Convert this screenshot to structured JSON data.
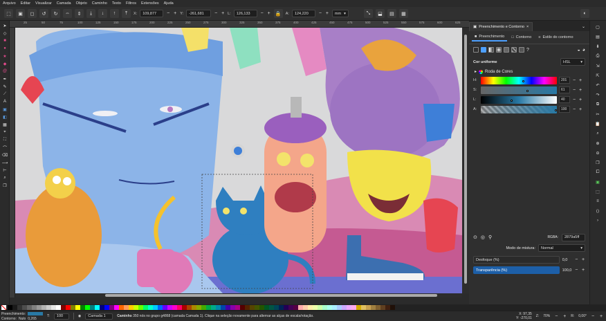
{
  "menu": [
    "Arquivo",
    "Editar",
    "Visualizar",
    "Camada",
    "Objeto",
    "Caminho",
    "Texto",
    "Filtros",
    "Extensões",
    "Ajuda"
  ],
  "toolcontrols": {
    "x_label": "X:",
    "x_value": "109,877",
    "y_label": "Y:",
    "y_value": "-261,681",
    "w_label": "L:",
    "w_value": "126,133",
    "h_label": "A:",
    "h_value": "124,220",
    "unit": "mm"
  },
  "ruler_ticks": [
    "25",
    "50",
    "75",
    "100",
    "125",
    "150",
    "175",
    "200",
    "225",
    "250",
    "275",
    "300",
    "325",
    "350",
    "375",
    "400",
    "425",
    "450",
    "475",
    "500",
    "525",
    "550",
    "575",
    "600",
    "625"
  ],
  "dock": {
    "tab_label": "Preenchimento e Contorno",
    "tabs": [
      "Preenchimento",
      "Contorno",
      "Estilo do contorno"
    ],
    "fill_title": "Cor uniforme",
    "color_mode": "HSL",
    "color_wheel": "Roda de Cores",
    "sliders": [
      {
        "label": "H:",
        "value": "201",
        "knob": 0.56
      },
      {
        "label": "S:",
        "value": "61",
        "knob": 0.61
      },
      {
        "label": "L:",
        "value": "40",
        "knob": 0.4
      },
      {
        "label": "A:",
        "value": "100",
        "knob": 1.0
      }
    ],
    "rgba_label": "RGBA:",
    "rgba_value": "2879a5ff",
    "blend_label": "Modo de mistura:",
    "blend_value": "Normal",
    "blur_label": "Desfoque (%)",
    "blur_value": "0,0",
    "opacity_label": "Transparência (%)",
    "opacity_value": "100,0"
  },
  "status": {
    "fill_label": "Preenchimento:",
    "stroke_label": "Contorno:",
    "stroke_value": "Nulo",
    "stroke_width": "0,265",
    "opacity_label": "T:",
    "opacity_value": "100",
    "layer": "Camada 1",
    "message_bold": "Caminho",
    "message": " 350 nós no grupo g4868 (camada Camada 1). Clique na seleção novamente para alternar as alças de escala/rotação.",
    "x_coord": "X: 97,35",
    "y_coord": "Y: -270,01",
    "zoom_label": "Z:",
    "zoom_value": "70%",
    "rotation_label": "R:",
    "rotation_value": "0,00°"
  },
  "colors": {
    "accent": "#4ea0ff",
    "selected_fill": "#2879a5",
    "opacity_bar": "#1d5fa8"
  },
  "palette": [
    "#000000",
    "#1a1a1a",
    "#333333",
    "#4d4d4d",
    "#666666",
    "#808080",
    "#999999",
    "#b3b3b3",
    "#cccccc",
    "#e6e6e6",
    "#ffffff",
    "#800000",
    "#ff0000",
    "#808000",
    "#ffff00",
    "#008000",
    "#00ff00",
    "#008080",
    "#00ffff",
    "#000080",
    "#0000ff",
    "#800080",
    "#ff00ff",
    "#ff6600",
    "#ff9955",
    "#ffcc00",
    "#ccff00",
    "#66ff00",
    "#00ff66",
    "#00ffcc",
    "#00ccff",
    "#0066ff",
    "#6600ff",
    "#cc00ff",
    "#ff00cc",
    "#ff0066",
    "#aa0000",
    "#aa4400",
    "#aa8800",
    "#88aa00",
    "#44aa00",
    "#00aa44",
    "#00aa88",
    "#0088aa",
    "#0044aa",
    "#4400aa",
    "#8800aa",
    "#aa0088",
    "#550000",
    "#552200",
    "#554400",
    "#445500",
    "#225500",
    "#005522",
    "#005544",
    "#004455",
    "#002255",
    "#220055",
    "#440055",
    "#550044",
    "#ffaaaa",
    "#ffccaa",
    "#ffeeaa",
    "#eeffaa",
    "#ccffaa",
    "#aaffcc",
    "#aaffee",
    "#aaeeff",
    "#aaccff",
    "#ccaaff",
    "#eeaaff",
    "#ffaaee",
    "#d4aa00",
    "#e0c060",
    "#c8a050",
    "#a08040",
    "#806030",
    "#604020",
    "#402010",
    "#201008"
  ]
}
